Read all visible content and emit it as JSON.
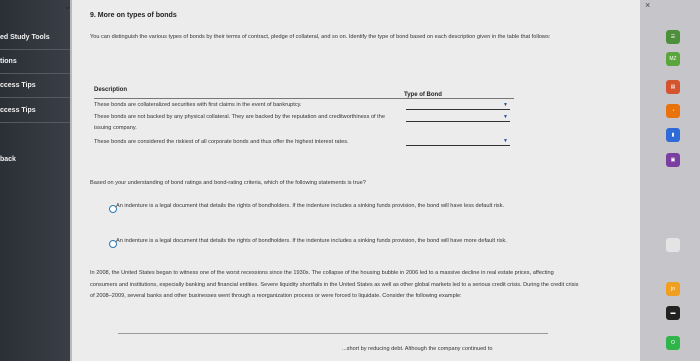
{
  "sidebar": {
    "items": [
      {
        "label": "ed Study Tools"
      },
      {
        "label": "tions"
      },
      {
        "label": "ccess Tips"
      },
      {
        "label": "ccess Tips"
      },
      {
        "label": "back"
      }
    ]
  },
  "question": {
    "title": "9. More on types of bonds",
    "intro": "You can distinguish the various types of bonds by their terms of contract, pledge of collateral, and so on. Identify the type of bond based on each description given in the table that follows:",
    "table": {
      "col_desc": "Description",
      "col_type": "Type of Bond",
      "rows": [
        {
          "text": "These bonds are collateralized securities with first claims in the event of bankruptcy.",
          "selected": ""
        },
        {
          "text": "These bonds are not backed by any physical collateral. They are backed by the reputation and creditworthiness of the issuing company.",
          "selected": ""
        },
        {
          "text": "These bonds are considered the riskiest of all corporate bonds and thus offer the highest interest rates.",
          "selected": ""
        }
      ]
    },
    "prompt": "Based on your understanding of bond ratings and bond-rating criteria, which of the following statements is true?",
    "options": [
      {
        "text": "An indenture is a legal document that details the rights of bondholders. If the indenture includes a sinking funds provision, the bond will have less default risk."
      },
      {
        "text": "An indenture is a legal document that details the rights of bondholders. If the indenture includes a sinking funds provision, the bond will have more default risk."
      }
    ],
    "paragraph": "In 2008, the United States began to witness one of the worst recessions since the 1930s. The collapse of the housing bubble in 2006 led to a massive decline in real estate prices, affecting consumers and institutions, especially banking and financial entities. Severe liquidity shortfalls in the United States as well as other global markets led to a serious credit crisis. During the credit crisis of 2008–2009, several banks and other businesses went through a reorganization process or were forced to liquidate. Consider the following example:",
    "bottom_text": "...short by reducing debt. Although the company continued to"
  },
  "window": {
    "close_label": "×",
    "chevron": "⌄"
  },
  "right_apps": [
    {
      "name": "app-a",
      "color": "#4d8f3a",
      "label": "☰"
    },
    {
      "name": "app-b",
      "color": "#5aa53c",
      "label": "MZ"
    },
    {
      "name": "app-c",
      "color": "#d3542f",
      "label": "▤"
    },
    {
      "name": "app-d",
      "color": "#e8730d",
      "label": "◔"
    },
    {
      "name": "app-e",
      "color": "#2f6bd8",
      "label": "▮"
    },
    {
      "name": "app-f",
      "color": "#7a3fa0",
      "label": "▣"
    },
    {
      "name": "app-g",
      "color": "#e4e4e4",
      "label": ""
    },
    {
      "name": "app-h",
      "color": "#f0a020",
      "label": "jo"
    },
    {
      "name": "app-i",
      "color": "#222222",
      "label": "▬"
    },
    {
      "name": "app-j",
      "color": "#2fb54a",
      "label": "O"
    }
  ]
}
